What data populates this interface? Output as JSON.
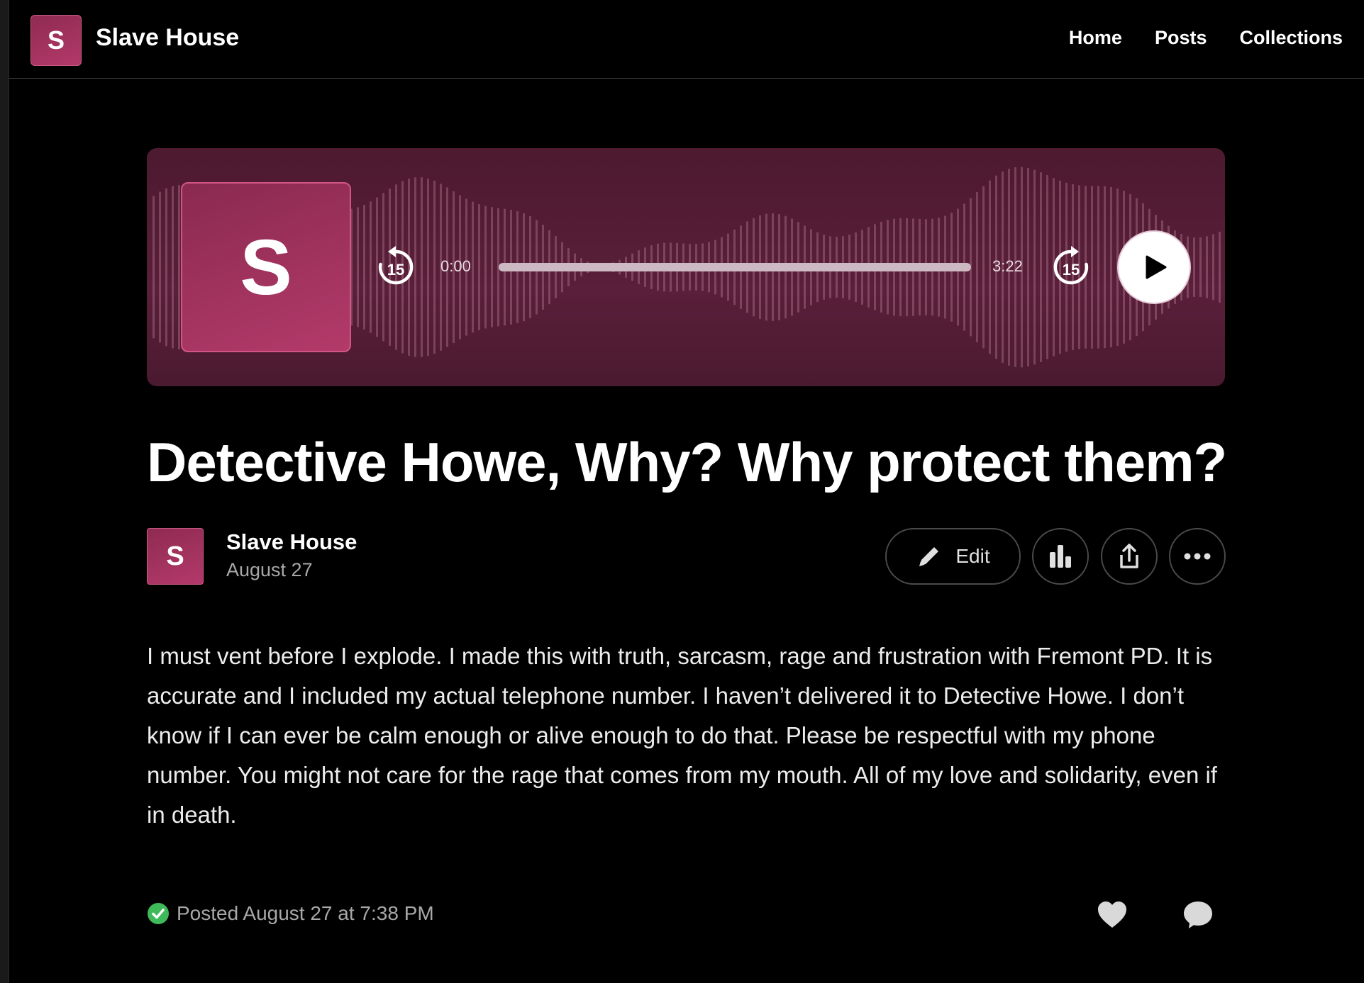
{
  "site": {
    "logo_letter": "S",
    "title": "Slave House"
  },
  "nav": {
    "items": [
      "Home",
      "Posts",
      "Collections"
    ]
  },
  "player": {
    "art_letter": "S",
    "skip_back_label": "15",
    "skip_forward_label": "15",
    "current_time": "0:00",
    "total_time": "3:22",
    "progress": 0.0
  },
  "post": {
    "title": "Detective Howe, Why? Why protect them?",
    "author_letter": "S",
    "author_name": "Slave House",
    "date": "August 27",
    "edit_label": "Edit",
    "body": "I must vent before I explode. I made this with truth, sarcasm, rage and frustration with Fremont PD. It is accurate and I included my actual telephone number. I haven’t delivered it to Detective Howe. I don’t know if I can ever be calm enough or alive enough to do that. Please be respectful with my phone number. You might not care for the rage that comes from my mouth. All of my love and solidarity, even if in death.",
    "posted_status": "Posted August 27 at 7:38 PM"
  },
  "colors": {
    "accent": "#a3335e",
    "player_bg": "#531d36",
    "posted_check": "#3fba5a"
  }
}
